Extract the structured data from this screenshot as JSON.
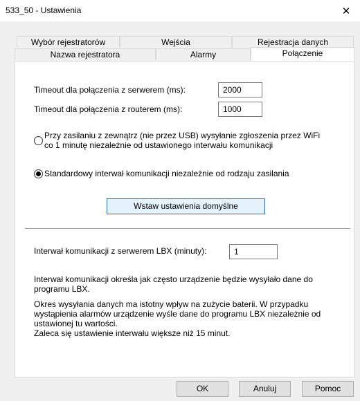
{
  "window": {
    "title": "533_50 - Ustawienia",
    "close_glyph": "✕"
  },
  "tabs": {
    "row1": [
      "Wybór rejestratorów",
      "Wejścia",
      "Rejestracja danych"
    ],
    "row2": [
      "Nazwa rejestratora",
      "Alarmy",
      "Połączenie"
    ],
    "active": "Połączenie"
  },
  "connection": {
    "server_timeout_label": "Timeout dla połączenia z serwerem (ms):",
    "server_timeout_value": "2000",
    "router_timeout_label": "Timeout dla połączenia z routerem (ms):",
    "router_timeout_value": "1000",
    "radio_external_power_line1": "Przy zasilaniu z zewnątrz (nie przez USB) wysyłanie zgłoszenia przez WiFi",
    "radio_external_power_line2": "co 1 minutę niezależnie od ustawionego interwału komunikacji",
    "radio_external_power_checked": false,
    "radio_standard_label": "Standardowy interwał komunikacji niezależnie od rodzaju zasilania",
    "radio_standard_checked": true,
    "defaults_button": "Wstaw ustawienia domyślne",
    "interval_label": "Interwał komunikacji z serwerem LBX (minuty):",
    "interval_value": "1",
    "info1_line1": "Interwał komunikacji określa jak często urządzenie będzie wysyłało dane do",
    "info1_line2": "programu LBX.",
    "info2_line1": "Okres wysyłania danych ma istotny wpływ na zużycie baterii. W przypadku",
    "info2_line2": "wystąpienia alarmów urządzenie wyśle dane do programu LBX niezależnie od",
    "info2_line3": "ustawionej tu wartości.",
    "info2_line4": "Zaleca się ustawienie interwału większe niż 15 minut."
  },
  "footer": {
    "ok": "OK",
    "cancel": "Anuluj",
    "help": "Pomoc"
  }
}
